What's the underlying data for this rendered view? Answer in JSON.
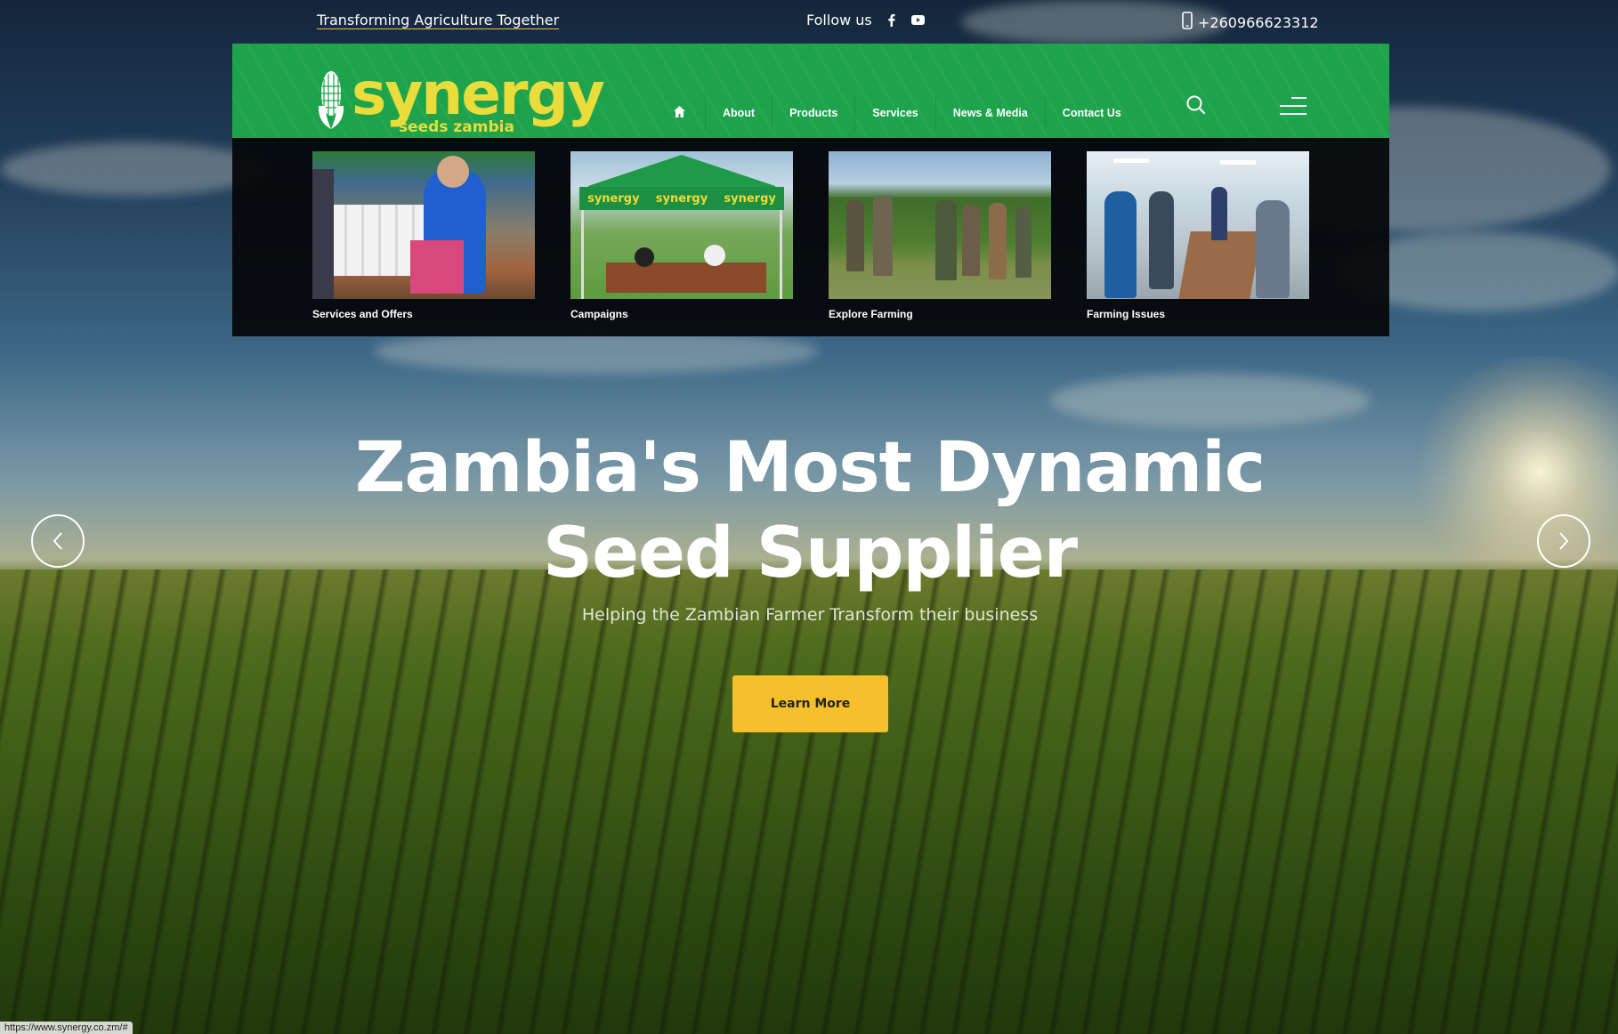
{
  "topbar": {
    "tagline": "Transforming Agriculture Together",
    "follow_label": "Follow us",
    "phone": "+260966623312"
  },
  "nav": {
    "items": [
      {
        "label": "About"
      },
      {
        "label": "Products"
      },
      {
        "label": "Services"
      },
      {
        "label": "News & Media"
      },
      {
        "label": "Contact Us"
      }
    ]
  },
  "logo": {
    "word": "synergy",
    "sub": "seeds zambia"
  },
  "mega_menu": {
    "cards": [
      {
        "label": "Services and Offers"
      },
      {
        "label": "Campaigns"
      },
      {
        "label": "Explore Farming"
      },
      {
        "label": "Farming Issues"
      }
    ],
    "tent_text": "synergy"
  },
  "hero": {
    "title": "Zambia's Most Dynamic Seed Supplier",
    "subtitle": "Helping the Zambian Farmer Transform their business",
    "cta": "Learn More"
  },
  "status_url": "https://www.synergy.co.zm/#",
  "colors": {
    "brand_green": "#1ea34c",
    "brand_yellow": "#e9dc3b",
    "cta_yellow": "#f6c02c"
  },
  "icons": [
    "facebook-icon",
    "youtube-icon",
    "phone-icon",
    "home-icon",
    "search-icon",
    "menu-icon",
    "chevron-left-icon",
    "chevron-right-icon",
    "corn-icon"
  ]
}
